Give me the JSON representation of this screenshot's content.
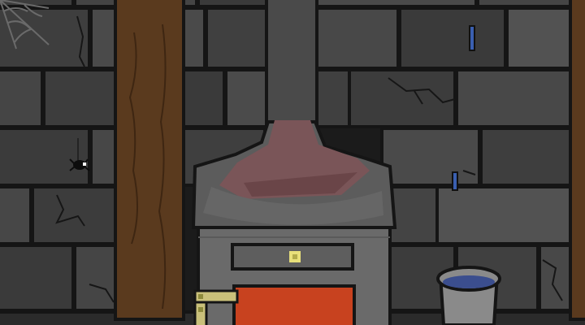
{
  "scene": {
    "description_visible_text": "",
    "palette": {
      "wall_mortar": "#1b1b1b",
      "brick_dark": "#3a3a3a",
      "brick_mid": "#454545",
      "brick_light": "#505050",
      "beam": "#5a3a1e",
      "beam_shadow": "#3e2612",
      "stove_body": "#6a6a6a",
      "stove_top": "#5e5e5e",
      "chimney": "#4a4a4a",
      "hood_glow": "#7a5558",
      "fire_door": "#c8421f",
      "knob": "#e8e07a",
      "bucket": "#8a8a8a",
      "water": "#3b4e8e",
      "blue_drip": "#3a5fb0"
    },
    "objects": [
      {
        "id": "cobweb",
        "icon": "cobweb-icon"
      },
      {
        "id": "spider",
        "icon": "spider-icon"
      },
      {
        "id": "left-beam",
        "icon": "wooden-beam-icon"
      },
      {
        "id": "right-beam",
        "icon": "wooden-beam-icon"
      },
      {
        "id": "chimney-pipe",
        "icon": "chimney-icon"
      },
      {
        "id": "stove",
        "icon": "stove-icon"
      },
      {
        "id": "stove-drawer",
        "icon": "drawer-icon"
      },
      {
        "id": "drawer-knob",
        "icon": "knob-icon"
      },
      {
        "id": "fire-door",
        "icon": "fire-door-icon"
      },
      {
        "id": "bucket",
        "icon": "bucket-icon"
      },
      {
        "id": "brass-bracket",
        "icon": "bracket-icon"
      },
      {
        "id": "blue-drip-upper",
        "icon": "water-drip-icon"
      },
      {
        "id": "blue-drip-lower",
        "icon": "water-drip-icon"
      }
    ]
  }
}
